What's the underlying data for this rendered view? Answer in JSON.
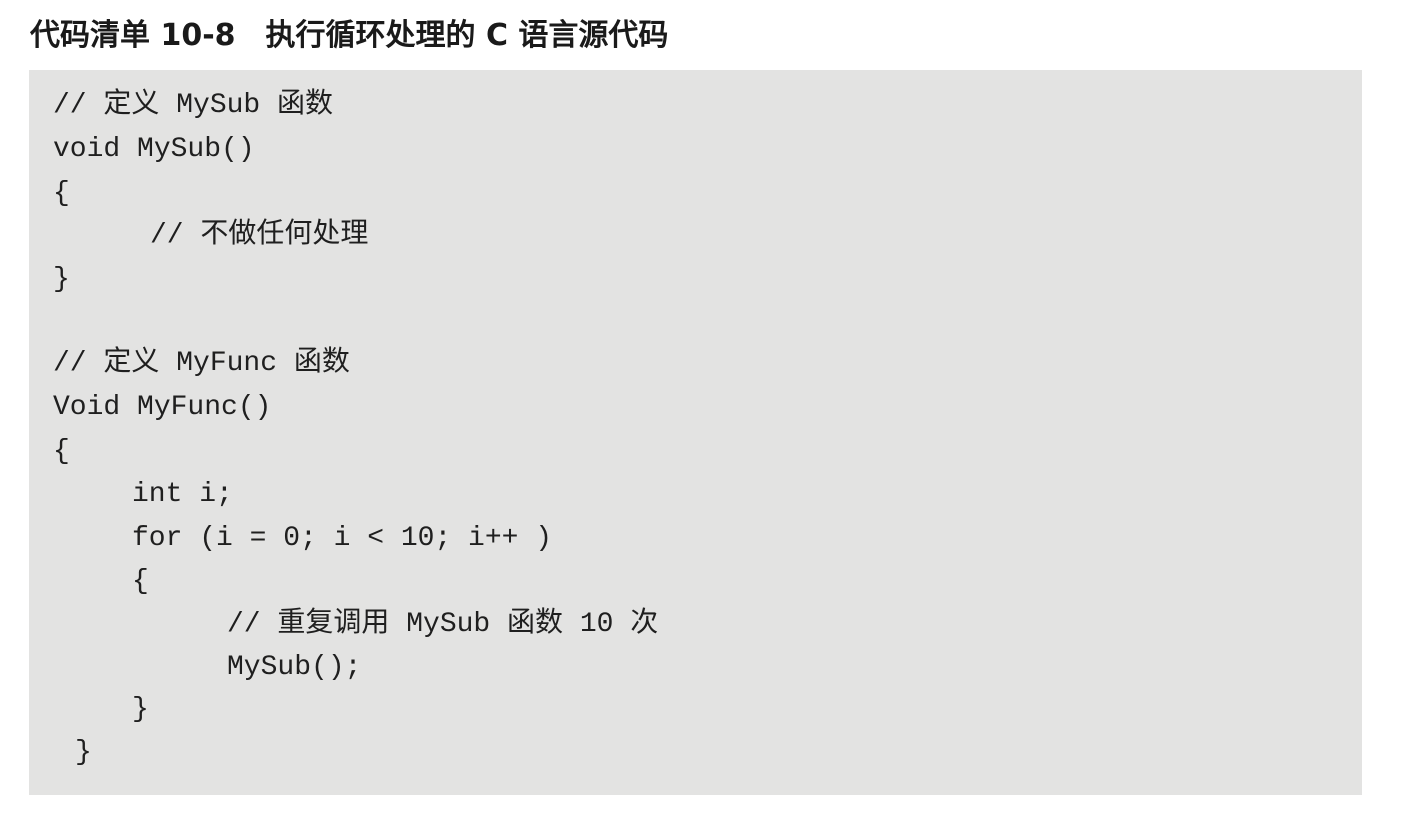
{
  "listing": {
    "title": "代码清单 10-8　执行循环处理的 C 语言源代码",
    "lines": [
      "// 定义 MySub 函数",
      "void MySub()",
      "{",
      "// 不做任何处理",
      "}",
      "// 定义 MyFunc 函数",
      "Void MyFunc()",
      "{",
      "int i;",
      "for (i = 0; i < 10; i++ )",
      "{",
      "// 重复调用 MySub 函数 10 次",
      "MySub();",
      "}",
      "}"
    ]
  }
}
